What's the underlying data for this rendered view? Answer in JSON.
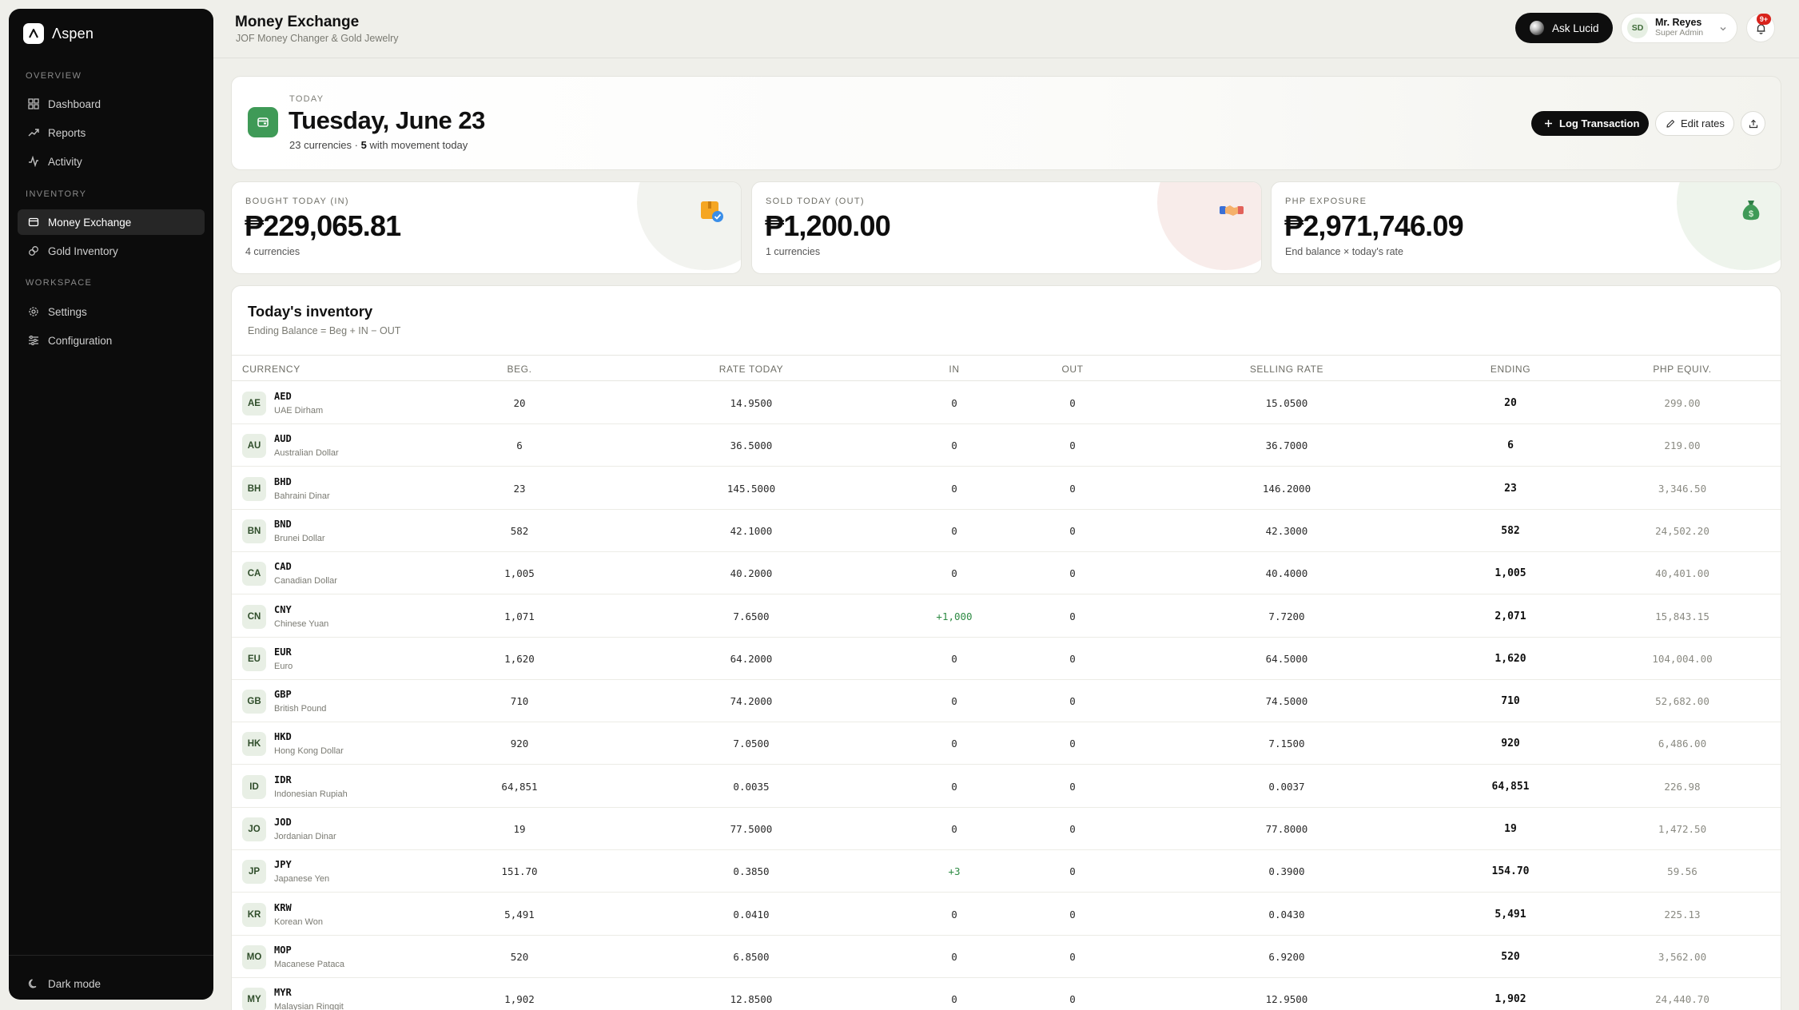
{
  "brand": {
    "name": "Λspen"
  },
  "sidebar": {
    "sections": [
      "OVERVIEW",
      "INVENTORY",
      "WORKSPACE"
    ],
    "items": [
      {
        "label": "Dashboard",
        "icon": "grid-icon"
      },
      {
        "label": "Reports",
        "icon": "trend-icon"
      },
      {
        "label": "Activity",
        "icon": "activity-icon"
      },
      {
        "label": "Money Exchange",
        "icon": "wallet-icon",
        "active": true
      },
      {
        "label": "Gold Inventory",
        "icon": "link-icon"
      },
      {
        "label": "Settings",
        "icon": "gear-icon"
      },
      {
        "label": "Configuration",
        "icon": "sliders-icon"
      }
    ],
    "dark_mode_label": "Dark mode"
  },
  "header": {
    "title": "Money Exchange",
    "subtitle": "JOF Money Changer & Gold Jewelry",
    "ask_label": "Ask Lucid",
    "user": {
      "initials": "SD",
      "name": "Mr. Reyes",
      "role": "Super Admin"
    },
    "notifications_badge": "9+"
  },
  "today": {
    "label": "TODAY",
    "date": "Tuesday, June 23",
    "meta_prefix": "23 currencies · ",
    "meta_count": "5",
    "meta_suffix": " with movement today",
    "log_label": "Log Transaction",
    "edit_label": "Edit rates"
  },
  "stats": [
    {
      "label": "BOUGHT TODAY (IN)",
      "value": "₱229,065.81",
      "sub": "4 currencies",
      "color": "#f5a623"
    },
    {
      "label": "SOLD TODAY (OUT)",
      "value": "₱1,200.00",
      "sub": "1 currencies",
      "color": "#e2625b"
    },
    {
      "label": "PHP EXPOSURE",
      "value": "₱2,971,746.09",
      "sub": "End balance × today's rate",
      "color": "#3f9a57"
    }
  ],
  "inventory": {
    "title": "Today's inventory",
    "subtitle": "Ending Balance = Beg + IN − OUT",
    "columns": [
      "CURRENCY",
      "BEG.",
      "RATE TODAY",
      "IN",
      "OUT",
      "SELLING RATE",
      "ENDING",
      "PHP EQUIV."
    ],
    "rows": [
      {
        "badge": "AE",
        "code": "AED",
        "name": "UAE Dirham",
        "beg": "20",
        "rate": "14.9500",
        "in": "0",
        "out": "0",
        "sell": "15.0500",
        "ending": "20",
        "php": "299.00"
      },
      {
        "badge": "AU",
        "code": "AUD",
        "name": "Australian Dollar",
        "beg": "6",
        "rate": "36.5000",
        "in": "0",
        "out": "0",
        "sell": "36.7000",
        "ending": "6",
        "php": "219.00"
      },
      {
        "badge": "BH",
        "code": "BHD",
        "name": "Bahraini Dinar",
        "beg": "23",
        "rate": "145.5000",
        "in": "0",
        "out": "0",
        "sell": "146.2000",
        "ending": "23",
        "php": "3,346.50"
      },
      {
        "badge": "BN",
        "code": "BND",
        "name": "Brunei Dollar",
        "beg": "582",
        "rate": "42.1000",
        "in": "0",
        "out": "0",
        "sell": "42.3000",
        "ending": "582",
        "php": "24,502.20"
      },
      {
        "badge": "CA",
        "code": "CAD",
        "name": "Canadian Dollar",
        "beg": "1,005",
        "rate": "40.2000",
        "in": "0",
        "out": "0",
        "sell": "40.4000",
        "ending": "1,005",
        "php": "40,401.00"
      },
      {
        "badge": "CN",
        "code": "CNY",
        "name": "Chinese Yuan",
        "beg": "1,071",
        "rate": "7.6500",
        "in": "+1,000",
        "out": "0",
        "sell": "7.7200",
        "ending": "2,071",
        "php": "15,843.15"
      },
      {
        "badge": "EU",
        "code": "EUR",
        "name": "Euro",
        "beg": "1,620",
        "rate": "64.2000",
        "in": "0",
        "out": "0",
        "sell": "64.5000",
        "ending": "1,620",
        "php": "104,004.00"
      },
      {
        "badge": "GB",
        "code": "GBP",
        "name": "British Pound",
        "beg": "710",
        "rate": "74.2000",
        "in": "0",
        "out": "0",
        "sell": "74.5000",
        "ending": "710",
        "php": "52,682.00"
      },
      {
        "badge": "HK",
        "code": "HKD",
        "name": "Hong Kong Dollar",
        "beg": "920",
        "rate": "7.0500",
        "in": "0",
        "out": "0",
        "sell": "7.1500",
        "ending": "920",
        "php": "6,486.00"
      },
      {
        "badge": "ID",
        "code": "IDR",
        "name": "Indonesian Rupiah",
        "beg": "64,851",
        "rate": "0.0035",
        "in": "0",
        "out": "0",
        "sell": "0.0037",
        "ending": "64,851",
        "php": "226.98"
      },
      {
        "badge": "JO",
        "code": "JOD",
        "name": "Jordanian Dinar",
        "beg": "19",
        "rate": "77.5000",
        "in": "0",
        "out": "0",
        "sell": "77.8000",
        "ending": "19",
        "php": "1,472.50"
      },
      {
        "badge": "JP",
        "code": "JPY",
        "name": "Japanese Yen",
        "beg": "151.70",
        "rate": "0.3850",
        "in": "+3",
        "out": "0",
        "sell": "0.3900",
        "ending": "154.70",
        "php": "59.56"
      },
      {
        "badge": "KR",
        "code": "KRW",
        "name": "Korean Won",
        "beg": "5,491",
        "rate": "0.0410",
        "in": "0",
        "out": "0",
        "sell": "0.0430",
        "ending": "5,491",
        "php": "225.13"
      },
      {
        "badge": "MO",
        "code": "MOP",
        "name": "Macanese Pataca",
        "beg": "520",
        "rate": "6.8500",
        "in": "0",
        "out": "0",
        "sell": "6.9200",
        "ending": "520",
        "php": "3,562.00"
      },
      {
        "badge": "MY",
        "code": "MYR",
        "name": "Malaysian Ringgit",
        "beg": "1,902",
        "rate": "12.8500",
        "in": "0",
        "out": "0",
        "sell": "12.9500",
        "ending": "1,902",
        "php": "24,440.70"
      }
    ]
  }
}
